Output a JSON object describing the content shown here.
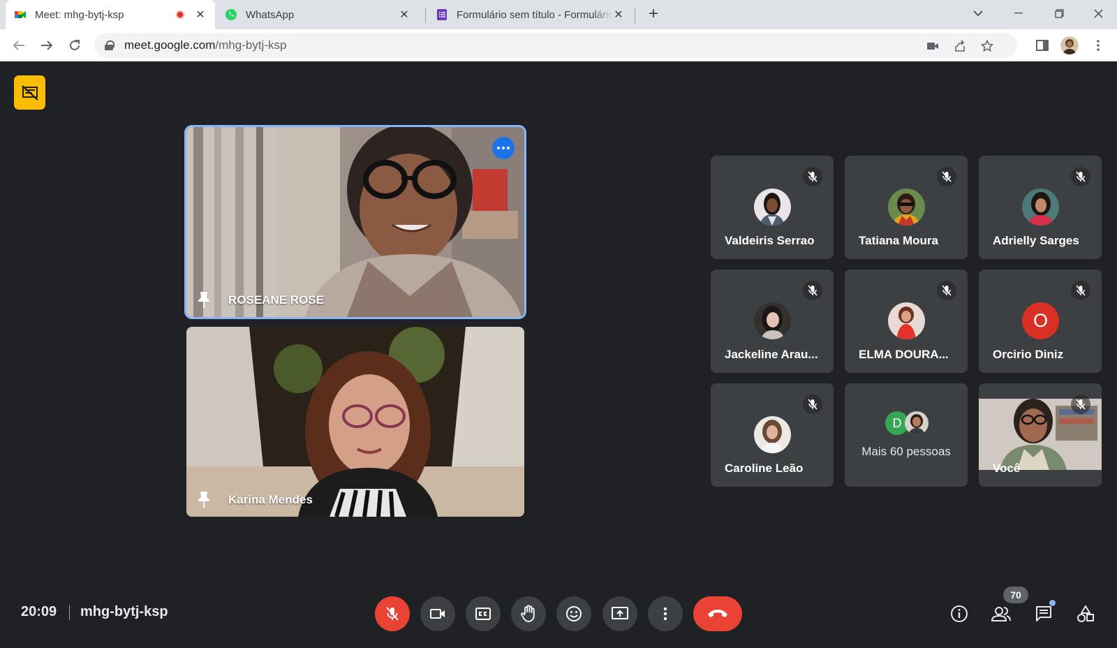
{
  "browser": {
    "tabs": [
      {
        "title": "Meet: mhg-bytj-ksp",
        "recording": true,
        "active": true
      },
      {
        "title": "WhatsApp",
        "active": false
      },
      {
        "title": "Formulário sem título - Formulários Google",
        "active": false
      }
    ],
    "url_host": "meet.google.com",
    "url_path": "/mhg-bytj-ksp"
  },
  "meeting": {
    "time": "20:09",
    "code": "mhg-bytj-ksp",
    "participant_count": "70",
    "pinned": [
      {
        "name": "ROSEANE ROSE",
        "highlighted": true
      },
      {
        "name": "Karina Mendes",
        "highlighted": false
      }
    ],
    "grid": [
      {
        "name": "Valdeiris Serrao",
        "muted": true,
        "avatar": "photo"
      },
      {
        "name": "Tatiana Moura",
        "muted": true,
        "avatar": "photo"
      },
      {
        "name": "Adrielly Sarges",
        "muted": true,
        "avatar": "photo"
      },
      {
        "name": "Jackeline Arau...",
        "muted": true,
        "avatar": "photo"
      },
      {
        "name": "ELMA DOURA...",
        "muted": true,
        "avatar": "photo"
      },
      {
        "name": "Orcirio Diniz",
        "muted": true,
        "avatar": "letter",
        "letter": "O",
        "color": "#d93025"
      },
      {
        "name": "Caroline Leão",
        "muted": true,
        "avatar": "photo"
      },
      {
        "name": "Mais 60 pessoas",
        "type": "overflow",
        "letter": "D",
        "color": "#34a853"
      },
      {
        "name": "Você",
        "muted": true,
        "avatar": "video"
      }
    ]
  },
  "controls": {
    "mic": "mic-off",
    "camera": "camera-on",
    "captions": "closed-captions",
    "hand": "raise-hand",
    "reactions": "emoji",
    "present": "present-screen",
    "more": "more-options",
    "end": "end-call"
  },
  "colors": {
    "accent": "#1a73e8",
    "danger": "#ea4335",
    "background": "#202124",
    "tile": "#3c4043",
    "warning": "#fbbc04"
  }
}
